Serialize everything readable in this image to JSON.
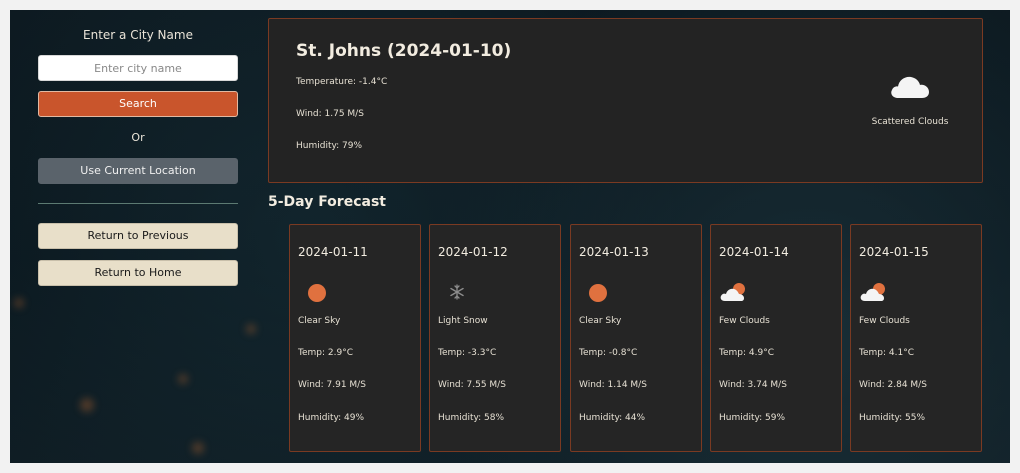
{
  "sidebar": {
    "city_label": "Enter a City Name",
    "city_placeholder": "Enter city name",
    "search_label": "Search",
    "or_label": "Or",
    "location_label": "Use Current Location",
    "previous_label": "Return to Previous",
    "home_label": "Return to Home"
  },
  "current": {
    "title": "St. Johns (2024-01-10)",
    "temperature": "Temperature: -1.4°C",
    "wind": "Wind: 1.75 M/S",
    "humidity": "Humidity: 79%",
    "condition": "Scattered Clouds",
    "icon": "cloud-icon"
  },
  "forecast_title": "5-Day Forecast",
  "forecast": [
    {
      "date": "2024-01-11",
      "icon": "sun-icon",
      "desc": "Clear Sky",
      "temp": "Temp: 2.9°C",
      "wind": "Wind: 7.91 M/S",
      "humidity": "Humidity: 49%"
    },
    {
      "date": "2024-01-12",
      "icon": "snowflake-icon",
      "desc": "Light Snow",
      "temp": "Temp: -3.3°C",
      "wind": "Wind: 7.55 M/S",
      "humidity": "Humidity: 58%"
    },
    {
      "date": "2024-01-13",
      "icon": "sun-icon",
      "desc": "Clear Sky",
      "temp": "Temp: -0.8°C",
      "wind": "Wind: 1.14 M/S",
      "humidity": "Humidity: 44%"
    },
    {
      "date": "2024-01-14",
      "icon": "few-clouds-icon",
      "desc": "Few Clouds",
      "temp": "Temp: 4.9°C",
      "wind": "Wind: 3.74 M/S",
      "humidity": "Humidity: 59%"
    },
    {
      "date": "2024-01-15",
      "icon": "few-clouds-icon",
      "desc": "Few Clouds",
      "temp": "Temp: 4.1°C",
      "wind": "Wind: 2.84 M/S",
      "humidity": "Humidity: 55%"
    }
  ],
  "colors": {
    "accent": "#c9552c",
    "card_border": "#7a3a22",
    "sun": "#e0713f"
  }
}
